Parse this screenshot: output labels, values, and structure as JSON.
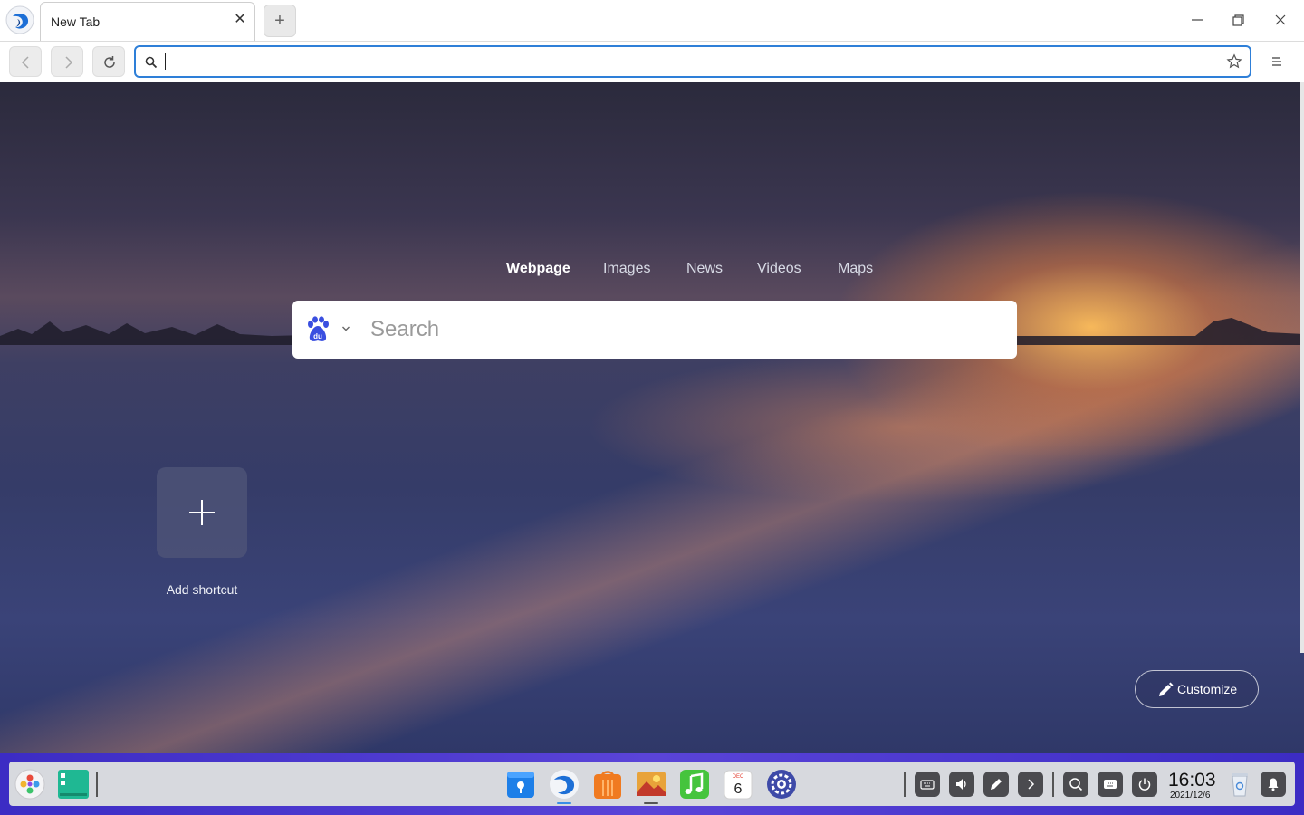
{
  "browser": {
    "tab_title": "New Tab",
    "address_value": "",
    "address_placeholder": ""
  },
  "newtab": {
    "search_tabs": [
      "Webpage",
      "Images",
      "News",
      "Videos",
      "Maps"
    ],
    "active_tab": "Webpage",
    "search_placeholder": "Search",
    "search_engine_icon": "baidu-paw-icon",
    "shortcut_label": "Add shortcut",
    "customize_label": "Customize"
  },
  "taskbar": {
    "time": "16:03",
    "date": "2021/12/6",
    "calendar_day": "6",
    "calendar_month": "DEC"
  },
  "colors": {
    "accent": "#2e7fd8",
    "taskbar_bg": "#d7d9de",
    "taskbar_border": "#4a36d0"
  }
}
